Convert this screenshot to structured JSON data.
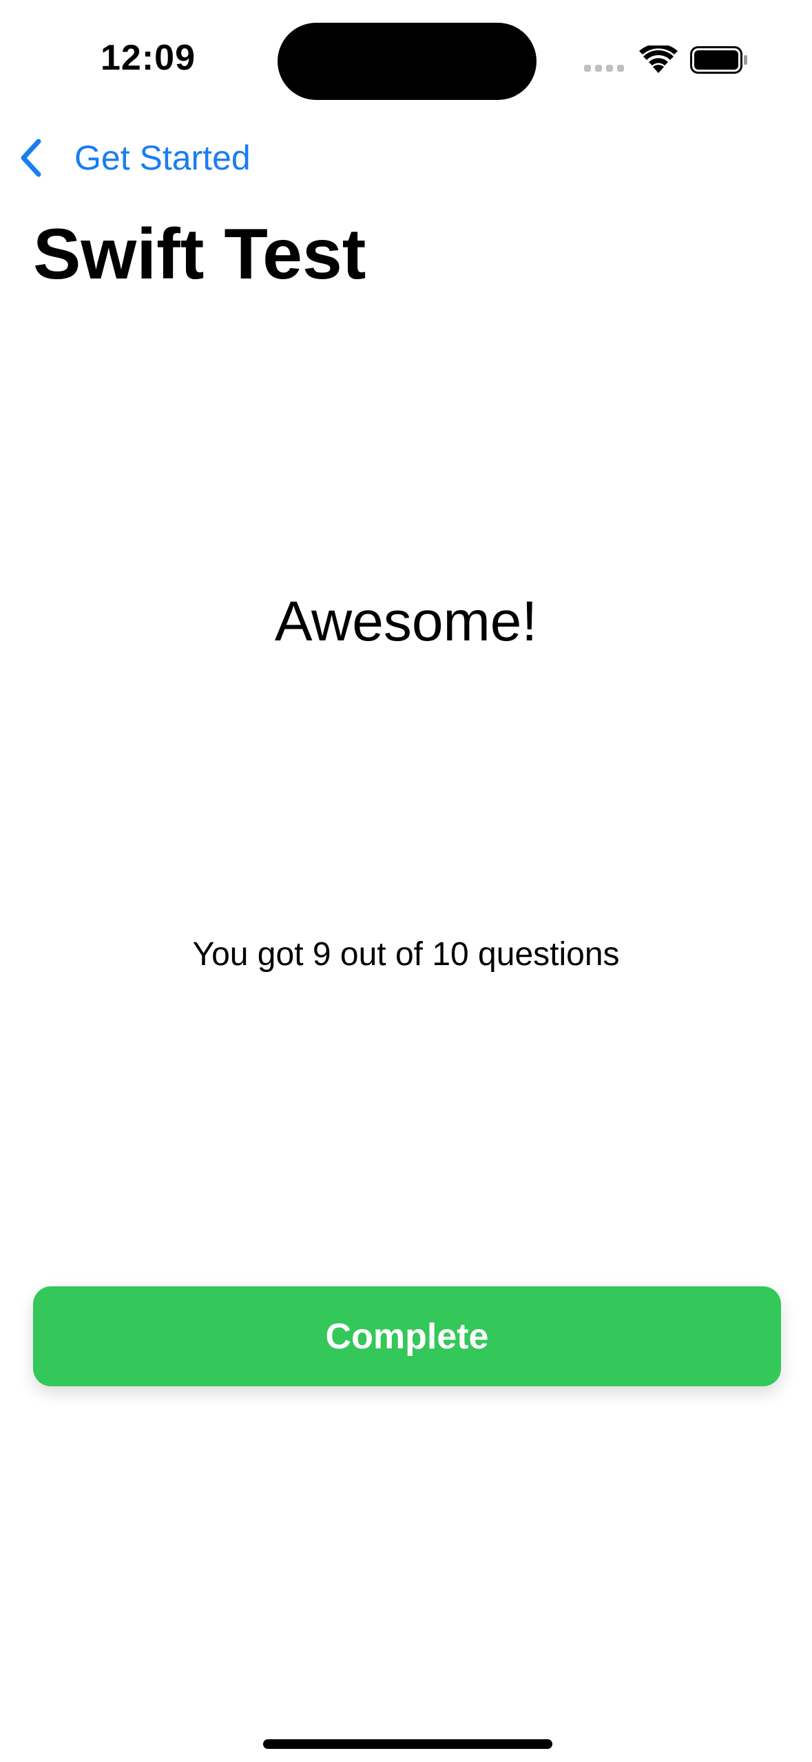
{
  "status_bar": {
    "time": "12:09",
    "icons": [
      "cellular-signal-icon",
      "wifi-icon",
      "battery-icon"
    ]
  },
  "nav": {
    "back_label": "Get Started",
    "back_icon": "chevron-left-icon",
    "accent_color": "#1a7df0"
  },
  "page": {
    "title": "Swift Test"
  },
  "result": {
    "headline": "Awesome!",
    "score_text": "You got 9 out of 10 questions"
  },
  "actions": {
    "complete_label": "Complete",
    "complete_color": "#34c759"
  }
}
